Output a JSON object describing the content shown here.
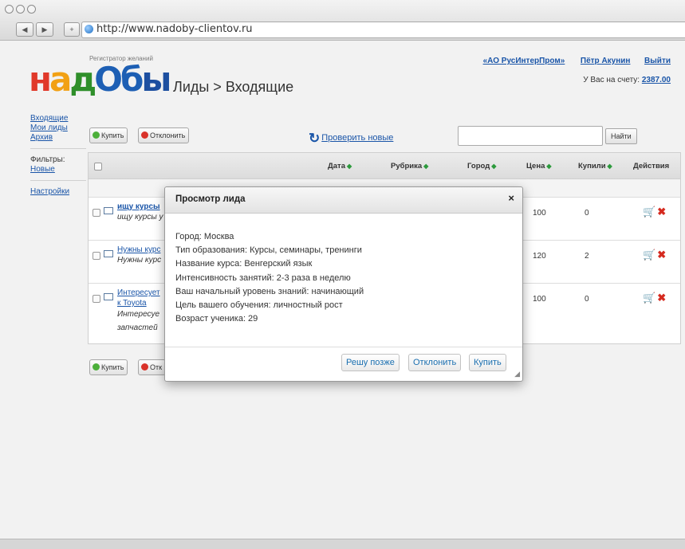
{
  "browser": {
    "url": "http://www.nadoby-clientov.ru",
    "back": "◀",
    "forward": "▶",
    "add": "+"
  },
  "brand": {
    "logo_letters": [
      "н",
      "а",
      "д",
      "О",
      "б",
      "ы"
    ],
    "tagline": "Регистратор желаний"
  },
  "page_title": "Лиды > Входящие",
  "account": {
    "company": "«АО РусИнтерПром»",
    "user": "Пётр Акунин",
    "logout": "Выйти",
    "balance_label": "У Вас на счету:",
    "balance": "2387.00"
  },
  "sidebar": {
    "incoming": "Входящие",
    "my_leads": "Мои лиды",
    "archive": "Архив",
    "filters_label": "Фильтры:",
    "filter_new": "Новые",
    "settings": "Настройки"
  },
  "toolbar": {
    "buy": "Купить",
    "reject": "Отклонить",
    "check_new": "Проверить новые",
    "search_placeholder": "",
    "find": "Найти"
  },
  "table": {
    "headers": {
      "date": "Дата",
      "rubric": "Рубрика",
      "city": "Город",
      "price": "Цена",
      "bought": "Купили",
      "actions": "Действия"
    },
    "rows": [
      {
        "title": "ищу курсы",
        "text": "ищу курсы у",
        "price": "100",
        "bought": "0"
      },
      {
        "title": "Нужны курс",
        "text": "Нужны курс",
        "price": "120",
        "bought": "2"
      },
      {
        "title": "Интересует",
        "title2": "к Toyota",
        "text": "Интересуе",
        "text2": "запчастей",
        "price": "100",
        "bought": "0"
      }
    ]
  },
  "bottom_toolbar": {
    "buy": "Купить",
    "reject": "Отк"
  },
  "modal": {
    "title": "Просмотр лида",
    "close": "×",
    "lines": [
      "Город: Москва",
      "Тип образования: Курсы, семинары, тренинги",
      "Название курса: Венгерский язык",
      "Интенсивность занятий: 2-3 раза в неделю",
      "Ваш начальный уровень знаний: начинающий",
      "Цель вашего обучения: личностный рост",
      "Возраст ученика: 29"
    ],
    "later": "Решу позже",
    "reject": "Отклонить",
    "buy": "Купить"
  },
  "colors": {
    "link": "#1a55a8",
    "buy_green": "#4caf3a",
    "reject_red": "#d9322a",
    "sort_arrow": "#2c9a3c"
  }
}
